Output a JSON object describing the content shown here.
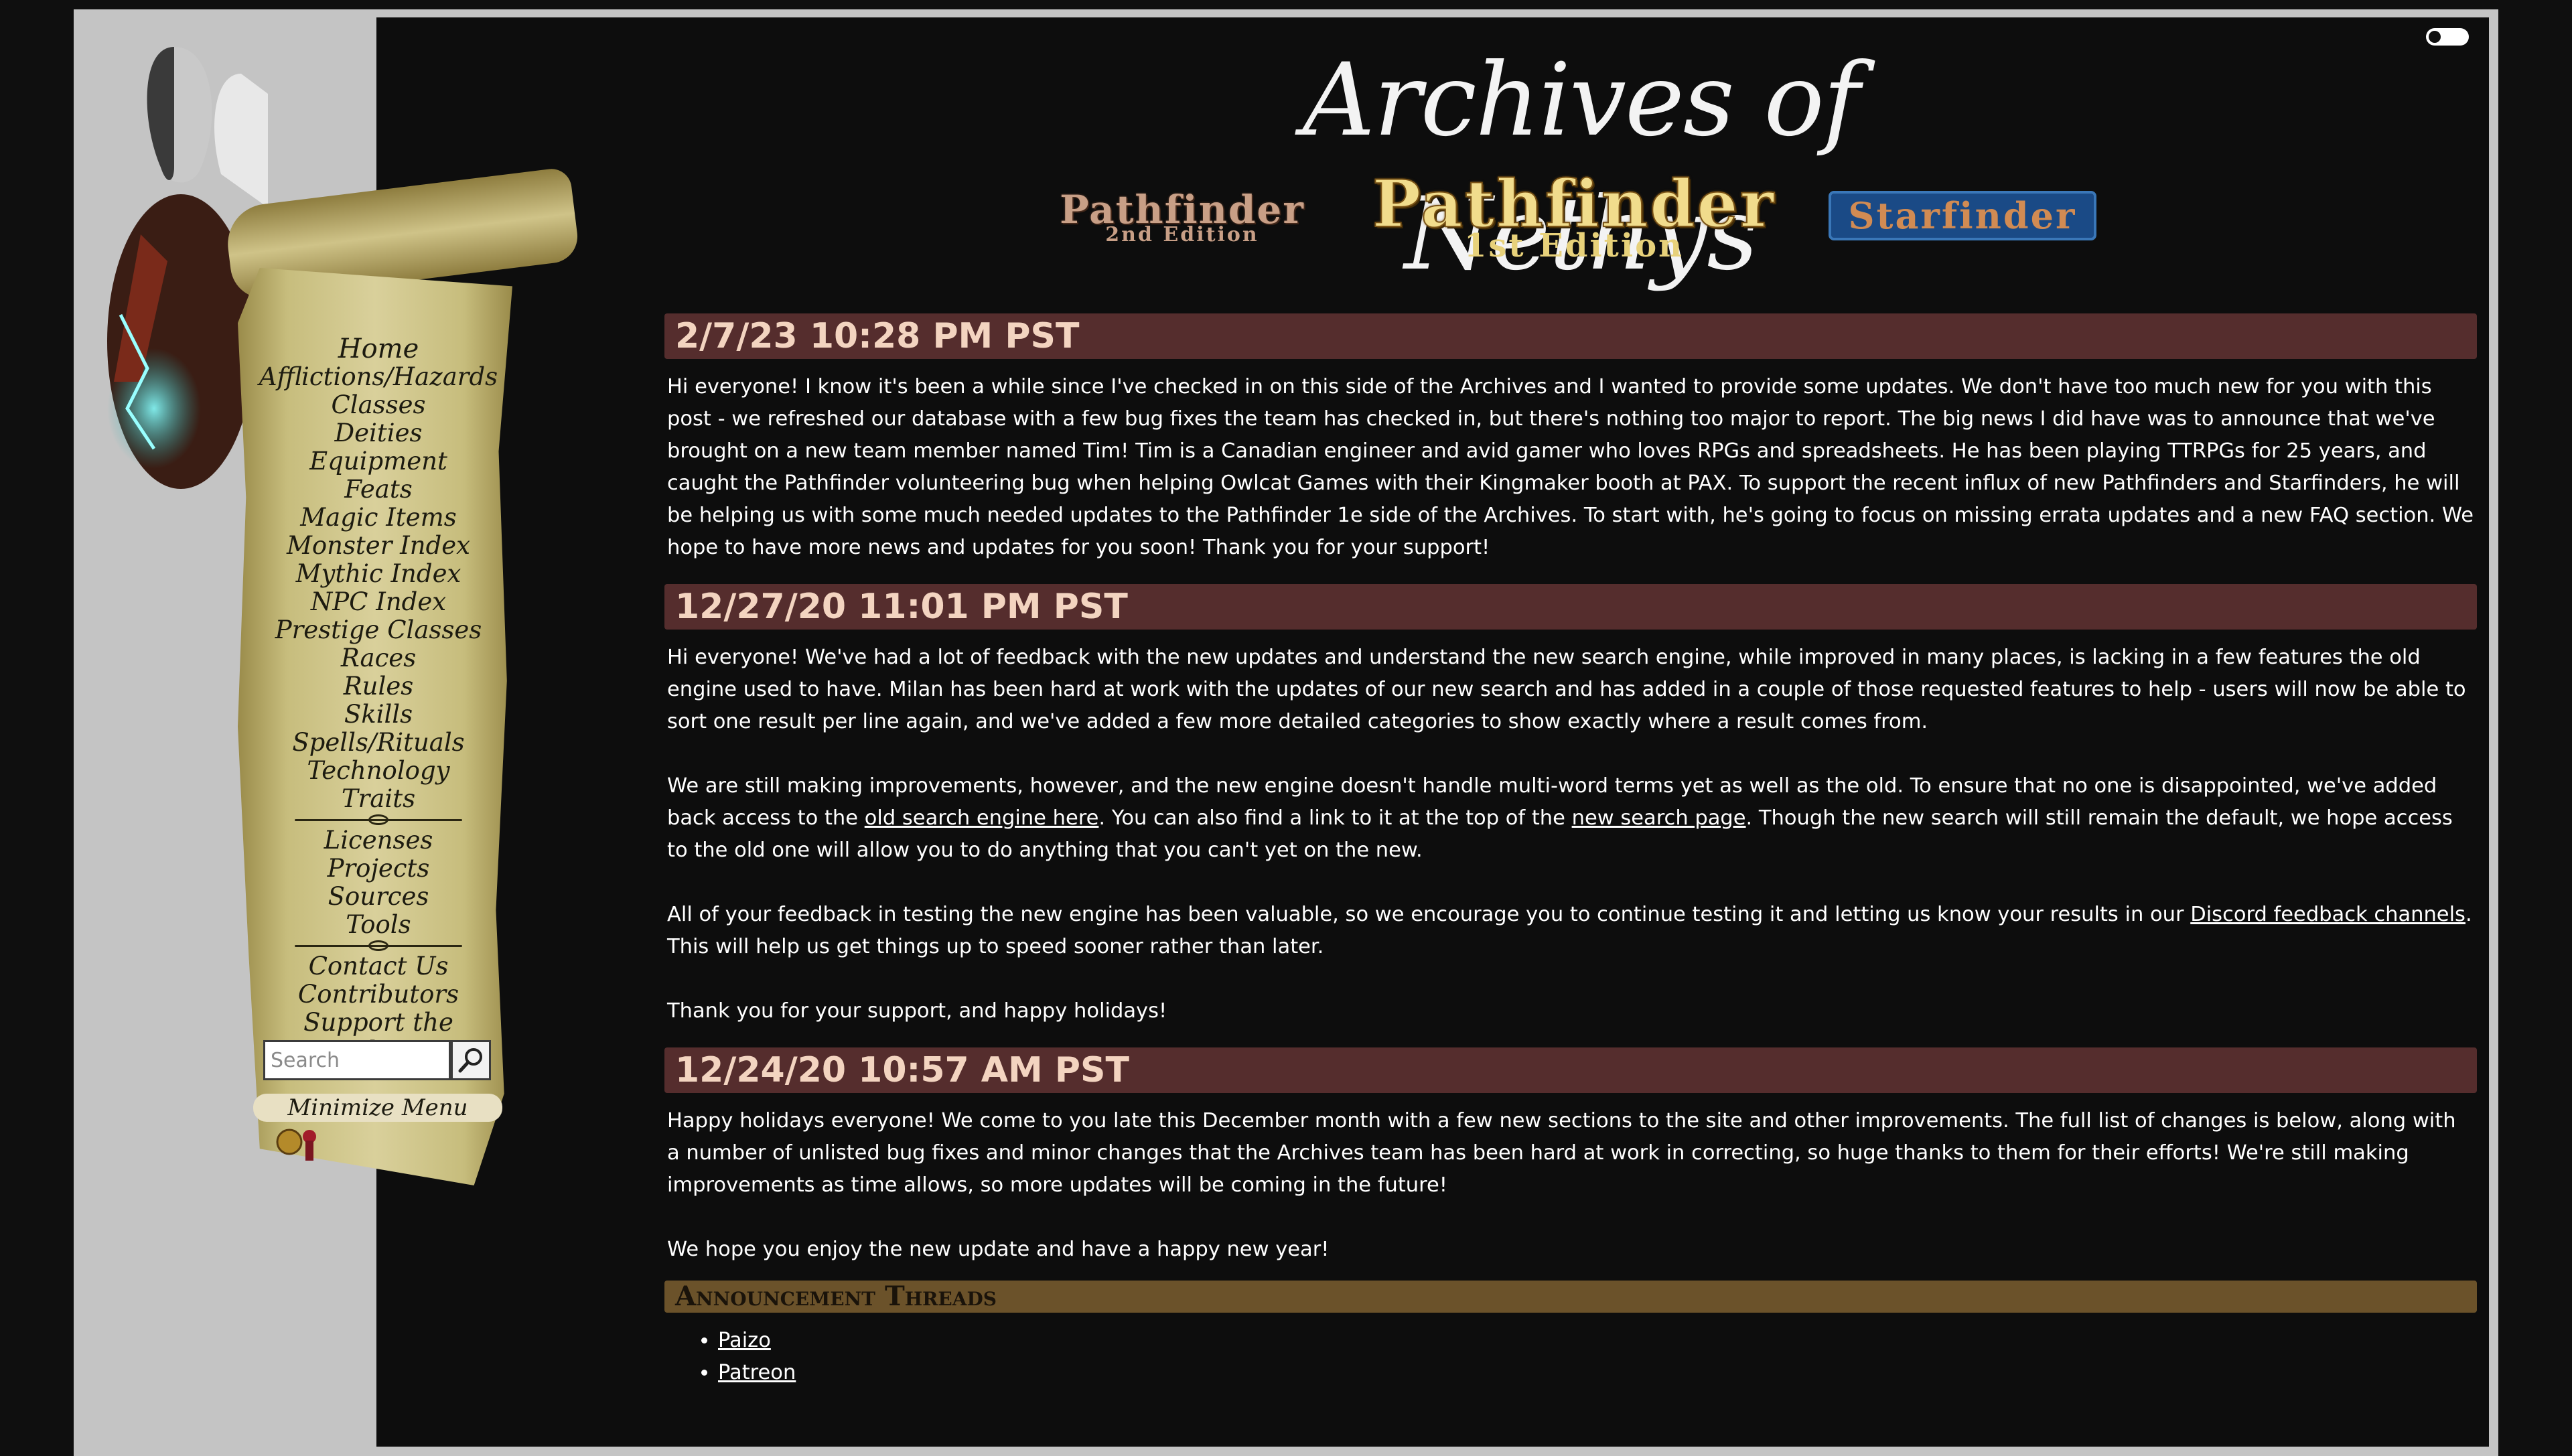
{
  "header": {
    "site_title": "Archives of Nethys",
    "theme_toggle": "theme-toggle"
  },
  "logos": {
    "pf2": {
      "line1": "Pathfinder",
      "line2": "2nd Edition"
    },
    "pf1": {
      "line1": "Pathfinder",
      "line2": "1st Edition"
    },
    "sf": {
      "line1": "Starfinder"
    }
  },
  "nav": {
    "items": [
      "Home",
      "Afflictions/Hazards",
      "Classes",
      "Deities",
      "Equipment",
      "Feats",
      "Magic Items",
      "Monster Index",
      "Mythic Index",
      "NPC Index",
      "Prestige Classes",
      "Races",
      "Rules",
      "Skills",
      "Spells/Rituals",
      "Technology",
      "Traits"
    ],
    "items2": [
      "Licenses",
      "Projects",
      "Sources",
      "Tools"
    ],
    "items3": [
      "Contact Us",
      "Contributors",
      "Support the Archives"
    ],
    "search_placeholder": "Search",
    "minimize_label": "Minimize Menu"
  },
  "posts": [
    {
      "date": "2/7/23 10:28 PM PST",
      "body": "Hi everyone! I know it's been a while since I've checked in on this side of the Archives and I wanted to provide some updates. We don't have too much new for you with this post - we refreshed our database with a few bug fixes the team has checked in, but there's nothing too major to report. The big news I did have was to announce that we've brought on a new team member named Tim! Tim is a Canadian engineer and avid gamer who loves RPGs and spreadsheets. He has been playing TTRPGs for 25 years, and caught the Pathfinder volunteering bug when helping Owlcat Games with their Kingmaker booth at PAX. To support the recent influx of new Pathfinders and Starfinders, he will be helping us with some much needed updates to the Pathfinder 1e side of the Archives. To start with, he's going to focus on missing errata updates and a new FAQ section. We hope to have more news and updates for you soon! Thank you for your support!"
    },
    {
      "date": "12/27/20 11:01 PM PST",
      "p1": "Hi everyone! We've had a lot of feedback with the new updates and understand the new search engine, while improved in many places, is lacking in a few features the old engine used to have. Milan has been hard at work with the updates of our new search and has added in a couple of those requested features to help - users will now be able to sort one result per line again, and we've added a few more detailed categories to show exactly where a result comes from.",
      "p2_a": "We are still making improvements, however, and the new engine doesn't handle multi-word terms yet as well as the old. To ensure that no one is disappointed, we've added back access to the ",
      "p2_link1": "old search engine here",
      "p2_b": ". You can also find a link to it at the top of the ",
      "p2_link2": "new search page",
      "p2_c": ". Though the new search will still remain the default, we hope access to the old one will allow you to do anything that you can't yet on the new.",
      "p3_a": "All of your feedback in testing the new engine has been valuable, so we encourage you to continue testing it and letting us know your results in our ",
      "p3_link": "Discord feedback channels",
      "p3_b": ". This will help us get things up to speed sooner rather than later.",
      "p4": "Thank you for your support, and happy holidays!"
    },
    {
      "date": "12/24/20 10:57 AM PST",
      "p1": "Happy holidays everyone! We come to you late this December month with a few new sections to the site and other improvements. The full list of changes is below, along with a number of unlisted bug fixes and minor changes that the Archives team has been hard at work in correcting, so huge thanks to them for their efforts! We're still making improvements as time allows, so more updates will be coming in the future!",
      "p2": "We hope you enjoy the new update and have a happy new year!"
    }
  ],
  "announcements": {
    "heading": "Announcement Threads",
    "links": [
      "Paizo",
      "Patreon"
    ]
  }
}
